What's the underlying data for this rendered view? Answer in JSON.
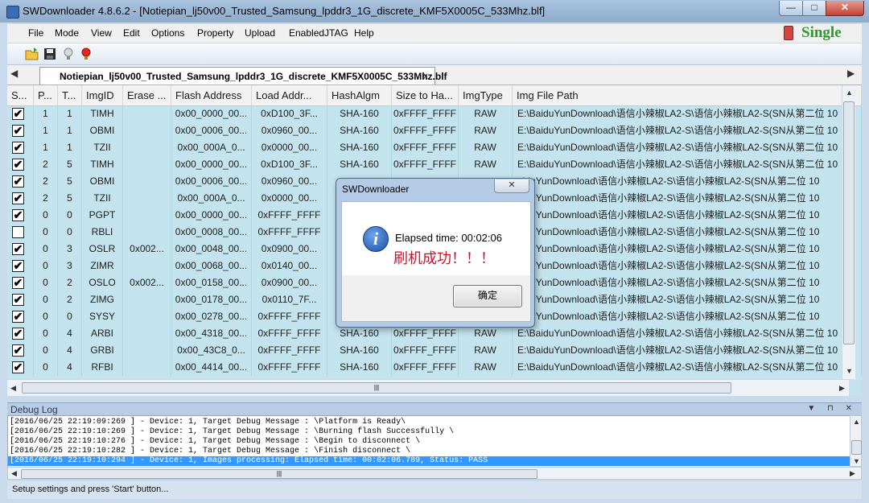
{
  "window": {
    "title": "SWDownloader 4.8.6.2 - [Notiepian_lj50v00_Trusted_Samsung_lpddr3_1G_discrete_KMF5X0005C_533Mhz.blf]"
  },
  "window_controls": {
    "minimize": "—",
    "maximize": "□",
    "close": "✕"
  },
  "menu": [
    "File",
    "Mode",
    "View",
    "Edit",
    "Options",
    "Property",
    "Upload",
    "EnabledJTAG",
    "Help"
  ],
  "mode_badge": "Single",
  "toolbar": {
    "icons": [
      "open-folder-icon",
      "save-icon",
      "bulb-off-icon",
      "bulb-on-icon"
    ]
  },
  "tab": {
    "label": "Notiepian_lj50v00_Trusted_Samsung_lpddr3_1G_discrete_KMF5X0005C_533Mhz.blf",
    "close": "x",
    "left_arrow": "◀",
    "right_arrow": "▶"
  },
  "table": {
    "headers": [
      "S...",
      "P...",
      "T...",
      "ImgID",
      "Erase ...",
      "Flash Address",
      "Load Addr...",
      "HashAlgm",
      "Size to Ha...",
      "ImgType",
      "Img File Path"
    ],
    "rows": [
      [
        "✔",
        "1",
        "1",
        "TIMH",
        "",
        "0x00_0000_00...",
        "0xD100_3F...",
        "SHA-160",
        "0xFFFF_FFFF",
        "RAW",
        "E:\\BaiduYunDownload\\语信小辣椒LA2-S\\语信小辣椒LA2-S(SN从第二位 10"
      ],
      [
        "✔",
        "1",
        "1",
        "OBMI",
        "",
        "0x00_0006_00...",
        "0x0960_00...",
        "SHA-160",
        "0xFFFF_FFFF",
        "RAW",
        "E:\\BaiduYunDownload\\语信小辣椒LA2-S\\语信小辣椒LA2-S(SN从第二位 10"
      ],
      [
        "✔",
        "1",
        "1",
        "TZII",
        "",
        "0x00_000A_0...",
        "0x0000_00...",
        "SHA-160",
        "0xFFFF_FFFF",
        "RAW",
        "E:\\BaiduYunDownload\\语信小辣椒LA2-S\\语信小辣椒LA2-S(SN从第二位 10"
      ],
      [
        "✔",
        "2",
        "5",
        "TIMH",
        "",
        "0x00_0000_00...",
        "0xD100_3F...",
        "SHA-160",
        "0xFFFF_FFFF",
        "RAW",
        "E:\\BaiduYunDownload\\语信小辣椒LA2-S\\语信小辣椒LA2-S(SN从第二位 10"
      ],
      [
        "✔",
        "2",
        "5",
        "OBMI",
        "",
        "0x00_0006_00...",
        "0x0960_00...",
        "",
        "",
        "",
        "aiduYunDownload\\语信小辣椒LA2-S\\语信小辣椒LA2-S(SN从第二位 10"
      ],
      [
        "✔",
        "2",
        "5",
        "TZII",
        "",
        "0x00_000A_0...",
        "0x0000_00...",
        "",
        "",
        "",
        "aiduYunDownload\\语信小辣椒LA2-S\\语信小辣椒LA2-S(SN从第二位 10"
      ],
      [
        "✔",
        "0",
        "0",
        "PGPT",
        "",
        "0x00_0000_00...",
        "0xFFFF_FFFF",
        "",
        "",
        "",
        "aiduYunDownload\\语信小辣椒LA2-S\\语信小辣椒LA2-S(SN从第二位 10"
      ],
      [
        "",
        "0",
        "0",
        "RBLI",
        "",
        "0x00_0008_00...",
        "0xFFFF_FFFF",
        "",
        "",
        "",
        "aiduYunDownload\\语信小辣椒LA2-S\\语信小辣椒LA2-S(SN从第二位 10"
      ],
      [
        "✔",
        "0",
        "3",
        "OSLR",
        "0x002...",
        "0x00_0048_00...",
        "0x0900_00...",
        "",
        "",
        "",
        "aiduYunDownload\\语信小辣椒LA2-S\\语信小辣椒LA2-S(SN从第二位 10"
      ],
      [
        "✔",
        "0",
        "3",
        "ZIMR",
        "",
        "0x00_0068_00...",
        "0x0140_00...",
        "",
        "",
        "",
        "aiduYunDownload\\语信小辣椒LA2-S\\语信小辣椒LA2-S(SN从第二位 10"
      ],
      [
        "✔",
        "0",
        "2",
        "OSLO",
        "0x002...",
        "0x00_0158_00...",
        "0x0900_00...",
        "",
        "",
        "",
        "aiduYunDownload\\语信小辣椒LA2-S\\语信小辣椒LA2-S(SN从第二位 10"
      ],
      [
        "✔",
        "0",
        "2",
        "ZIMG",
        "",
        "0x00_0178_00...",
        "0x0110_7F...",
        "",
        "",
        "",
        "aiduYunDownload\\语信小辣椒LA2-S\\语信小辣椒LA2-S(SN从第二位 10"
      ],
      [
        "✔",
        "0",
        "0",
        "SYSY",
        "",
        "0x00_0278_00...",
        "0xFFFF_FFFF",
        "",
        "",
        "",
        "aiduYunDownload\\语信小辣椒LA2-S\\语信小辣椒LA2-S(SN从第二位 10"
      ],
      [
        "✔",
        "0",
        "4",
        "ARBI",
        "",
        "0x00_4318_00...",
        "0xFFFF_FFFF",
        "SHA-160",
        "0xFFFF_FFFF",
        "RAW",
        "E:\\BaiduYunDownload\\语信小辣椒LA2-S\\语信小辣椒LA2-S(SN从第二位 10"
      ],
      [
        "✔",
        "0",
        "4",
        "GRBI",
        "",
        "0x00_43C8_0...",
        "0xFFFF_FFFF",
        "SHA-160",
        "0xFFFF_FFFF",
        "RAW",
        "E:\\BaiduYunDownload\\语信小辣椒LA2-S\\语信小辣椒LA2-S(SN从第二位 10"
      ],
      [
        "✔",
        "0",
        "4",
        "RFBI",
        "",
        "0x00_4414_00...",
        "0xFFFF_FFFF",
        "SHA-160",
        "0xFFFF_FFFF",
        "RAW",
        "E:\\BaiduYunDownload\\语信小辣椒LA2-S\\语信小辣椒LA2-S(SN从第二位 10"
      ]
    ]
  },
  "debug_log": {
    "title": "Debug Log",
    "buttons": "▼ ⊓ ✕",
    "lines": [
      "[2016/06/25 22:19:09:269 ] - Device: 1, Target Debug Message : \\Platform is Ready\\",
      "[2016/06/25 22:19:10:269 ] - Device: 1, Target Debug Message : \\Burning flash Successfully \\",
      "[2016/06/25 22:19:10:276 ] - Device: 1, Target Debug Message : \\Begin to disconnect \\",
      "[2016/06/25 22:19:10:282 ] - Device: 1, Target Debug Message : \\Finish disconnect \\",
      "[2016/06/25 22:19:10:294 ] - Device: 1, Images processing: Elapsed time: 00:02:06.789, Status: PASS"
    ],
    "selected_line": 4
  },
  "status_bar": "Setup settings and press 'Start' button...",
  "dialog": {
    "title": "SWDownloader",
    "close": "✕",
    "icon": "info-icon",
    "message": "Elapsed time: 00:02:06",
    "message_cn": "刷机成功！！！",
    "ok_label": "确定"
  },
  "scroll": {
    "up": "▲",
    "down": "▼",
    "left": "◀",
    "right": "▶",
    "grip": "|||"
  }
}
